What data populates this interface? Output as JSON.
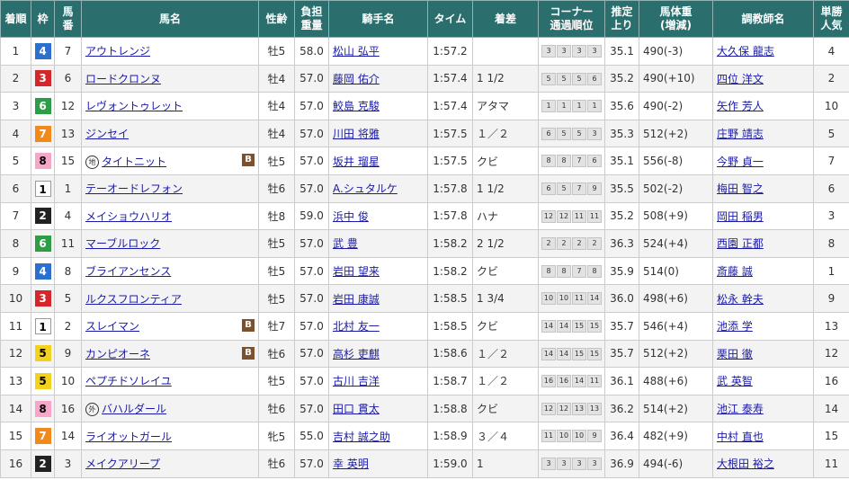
{
  "colors": {
    "header_bg": "#2b6e6e",
    "link": "#1a1aa6",
    "waku": {
      "1": "#ffffff",
      "2": "#222222",
      "3": "#d6262b",
      "4": "#2d6fcf",
      "5": "#f2d21d",
      "6": "#2e9e46",
      "7": "#f28a1b",
      "8": "#f5a6c9"
    },
    "blinker_badge": "#7a5230"
  },
  "headers": {
    "rank": "着順",
    "waku": "枠",
    "umaban": [
      "馬",
      "番"
    ],
    "horse": "馬名",
    "sexage": "性齢",
    "weight": [
      "負担",
      "重量"
    ],
    "jockey": "騎手名",
    "time": "タイム",
    "margin": "着差",
    "corner": [
      "コーナー",
      "通過順位"
    ],
    "last3f": [
      "推定",
      "上り"
    ],
    "bodyweight": [
      "馬体重",
      "(増減)"
    ],
    "trainer": "調教師名",
    "pop": [
      "単勝",
      "人気"
    ]
  },
  "rows": [
    {
      "rank": "1",
      "waku": "4",
      "umaban": "7",
      "mark": "",
      "horse": "アウトレンジ",
      "blinker": "",
      "sexage": "牡5",
      "weight": "58.0",
      "jockey": "松山 弘平",
      "time": "1:57.2",
      "margin": "",
      "corner": [
        "3",
        "3",
        "3",
        "3"
      ],
      "last3f": "35.1",
      "bodyweight": "490(-3)",
      "trainer": "大久保 龍志",
      "pop": "4"
    },
    {
      "rank": "2",
      "waku": "3",
      "umaban": "6",
      "mark": "",
      "horse": "ロードクロンヌ",
      "blinker": "",
      "sexage": "牡4",
      "weight": "57.0",
      "jockey": "藤岡 佑介",
      "time": "1:57.4",
      "margin": "1 1/2",
      "corner": [
        "5",
        "5",
        "5",
        "6"
      ],
      "last3f": "35.2",
      "bodyweight": "490(+10)",
      "trainer": "四位 洋文",
      "pop": "2"
    },
    {
      "rank": "3",
      "waku": "6",
      "umaban": "12",
      "mark": "",
      "horse": "レヴォントゥレット",
      "blinker": "",
      "sexage": "牡4",
      "weight": "57.0",
      "jockey": "鮫島 克駿",
      "time": "1:57.4",
      "margin": "アタマ",
      "corner": [
        "1",
        "1",
        "1",
        "1"
      ],
      "last3f": "35.6",
      "bodyweight": "490(-2)",
      "trainer": "矢作 芳人",
      "pop": "10"
    },
    {
      "rank": "4",
      "waku": "7",
      "umaban": "13",
      "mark": "",
      "horse": "ジンセイ",
      "blinker": "",
      "sexage": "牡4",
      "weight": "57.0",
      "jockey": "川田 将雅",
      "time": "1:57.5",
      "margin": "１／２",
      "corner": [
        "6",
        "5",
        "5",
        "3"
      ],
      "last3f": "35.3",
      "bodyweight": "512(+2)",
      "trainer": "庄野 靖志",
      "pop": "5"
    },
    {
      "rank": "5",
      "waku": "8",
      "umaban": "15",
      "mark": "地",
      "horse": "タイトニット",
      "blinker": "B",
      "sexage": "牡5",
      "weight": "57.0",
      "jockey": "坂井 瑠星",
      "time": "1:57.5",
      "margin": "クビ",
      "corner": [
        "8",
        "8",
        "7",
        "6"
      ],
      "last3f": "35.1",
      "bodyweight": "556(-8)",
      "trainer": "今野 貞一",
      "pop": "7"
    },
    {
      "rank": "6",
      "waku": "1",
      "umaban": "1",
      "mark": "",
      "horse": "テーオードレフォン",
      "blinker": "",
      "sexage": "牡6",
      "weight": "57.0",
      "jockey": "A.シュタルケ",
      "time": "1:57.8",
      "margin": "1 1/2",
      "corner": [
        "6",
        "5",
        "7",
        "9"
      ],
      "last3f": "35.5",
      "bodyweight": "502(-2)",
      "trainer": "梅田 智之",
      "pop": "6"
    },
    {
      "rank": "7",
      "waku": "2",
      "umaban": "4",
      "mark": "",
      "horse": "メイショウハリオ",
      "blinker": "",
      "sexage": "牡8",
      "weight": "59.0",
      "jockey": "浜中 俊",
      "time": "1:57.8",
      "margin": "ハナ",
      "corner": [
        "12",
        "12",
        "11",
        "11"
      ],
      "last3f": "35.2",
      "bodyweight": "508(+9)",
      "trainer": "岡田 稲男",
      "pop": "3"
    },
    {
      "rank": "8",
      "waku": "6",
      "umaban": "11",
      "mark": "",
      "horse": "マーブルロック",
      "blinker": "",
      "sexage": "牡5",
      "weight": "57.0",
      "jockey": "武 豊",
      "time": "1:58.2",
      "margin": "2 1/2",
      "corner": [
        "2",
        "2",
        "2",
        "2"
      ],
      "last3f": "36.3",
      "bodyweight": "524(+4)",
      "trainer": "西園 正都",
      "pop": "8"
    },
    {
      "rank": "9",
      "waku": "4",
      "umaban": "8",
      "mark": "",
      "horse": "ブライアンセンス",
      "blinker": "",
      "sexage": "牡5",
      "weight": "57.0",
      "jockey": "岩田 望来",
      "time": "1:58.2",
      "margin": "クビ",
      "corner": [
        "8",
        "8",
        "7",
        "8"
      ],
      "last3f": "35.9",
      "bodyweight": "514(0)",
      "trainer": "斎藤 誠",
      "pop": "1"
    },
    {
      "rank": "10",
      "waku": "3",
      "umaban": "5",
      "mark": "",
      "horse": "ルクスフロンティア",
      "blinker": "",
      "sexage": "牡5",
      "weight": "57.0",
      "jockey": "岩田 康誠",
      "time": "1:58.5",
      "margin": "1 3/4",
      "corner": [
        "10",
        "10",
        "11",
        "14"
      ],
      "last3f": "36.0",
      "bodyweight": "498(+6)",
      "trainer": "松永 幹夫",
      "pop": "9"
    },
    {
      "rank": "11",
      "waku": "1",
      "umaban": "2",
      "mark": "",
      "horse": "スレイマン",
      "blinker": "B",
      "sexage": "牡7",
      "weight": "57.0",
      "jockey": "北村 友一",
      "time": "1:58.5",
      "margin": "クビ",
      "corner": [
        "14",
        "14",
        "15",
        "15"
      ],
      "last3f": "35.7",
      "bodyweight": "546(+4)",
      "trainer": "池添 学",
      "pop": "13"
    },
    {
      "rank": "12",
      "waku": "5",
      "umaban": "9",
      "mark": "",
      "horse": "カンピオーネ",
      "blinker": "B",
      "sexage": "牡6",
      "weight": "57.0",
      "jockey": "高杉 吏麒",
      "time": "1:58.6",
      "margin": "１／２",
      "corner": [
        "14",
        "14",
        "15",
        "15"
      ],
      "last3f": "35.7",
      "bodyweight": "512(+2)",
      "trainer": "栗田 徹",
      "pop": "12"
    },
    {
      "rank": "13",
      "waku": "5",
      "umaban": "10",
      "mark": "",
      "horse": "ペプチドソレイユ",
      "blinker": "",
      "sexage": "牡5",
      "weight": "57.0",
      "jockey": "古川 吉洋",
      "time": "1:58.7",
      "margin": "１／２",
      "corner": [
        "16",
        "16",
        "14",
        "11"
      ],
      "last3f": "36.1",
      "bodyweight": "488(+6)",
      "trainer": "武 英智",
      "pop": "16"
    },
    {
      "rank": "14",
      "waku": "8",
      "umaban": "16",
      "mark": "外",
      "horse": "バハルダール",
      "blinker": "",
      "sexage": "牡6",
      "weight": "57.0",
      "jockey": "田口 貫太",
      "time": "1:58.8",
      "margin": "クビ",
      "corner": [
        "12",
        "12",
        "13",
        "13"
      ],
      "last3f": "36.2",
      "bodyweight": "514(+2)",
      "trainer": "池江 泰寿",
      "pop": "14"
    },
    {
      "rank": "15",
      "waku": "7",
      "umaban": "14",
      "mark": "",
      "horse": "ライオットガール",
      "blinker": "",
      "sexage": "牝5",
      "weight": "55.0",
      "jockey": "吉村 誠之助",
      "time": "1:58.9",
      "margin": "３／４",
      "corner": [
        "11",
        "10",
        "10",
        "9"
      ],
      "last3f": "36.4",
      "bodyweight": "482(+9)",
      "trainer": "中村 直也",
      "pop": "15"
    },
    {
      "rank": "16",
      "waku": "2",
      "umaban": "3",
      "mark": "",
      "horse": "メイクアリープ",
      "blinker": "",
      "sexage": "牡6",
      "weight": "57.0",
      "jockey": "幸 英明",
      "time": "1:59.0",
      "margin": "1",
      "corner": [
        "3",
        "3",
        "3",
        "3"
      ],
      "last3f": "36.9",
      "bodyweight": "494(-6)",
      "trainer": "大根田 裕之",
      "pop": "11"
    }
  ]
}
